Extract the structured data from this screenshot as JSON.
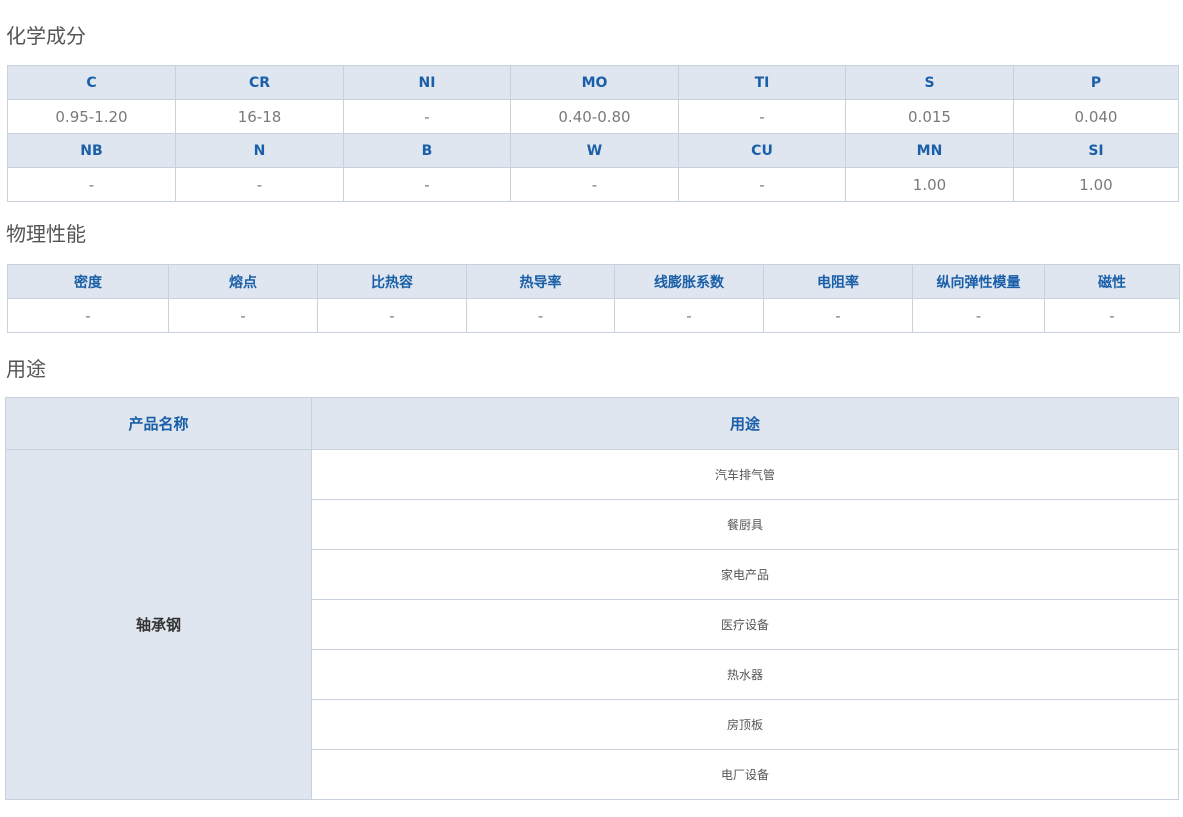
{
  "chemical": {
    "title": "化学成分",
    "rows": [
      {
        "headers": [
          "C",
          "CR",
          "NI",
          "MO",
          "TI",
          "S",
          "P"
        ],
        "values": [
          "0.95-1.20",
          "16-18",
          "-",
          "0.40-0.80",
          "-",
          "0.015",
          "0.040"
        ]
      },
      {
        "headers": [
          "NB",
          "N",
          "B",
          "W",
          "CU",
          "MN",
          "SI"
        ],
        "values": [
          "-",
          "-",
          "-",
          "-",
          "-",
          "1.00",
          "1.00"
        ]
      }
    ]
  },
  "physical": {
    "title": "物理性能",
    "headers": [
      "密度",
      "熔点",
      "比热容",
      "热导率",
      "线膨胀系数",
      "电阻率",
      "纵向弹性模量",
      "磁性"
    ],
    "values": [
      "-",
      "-",
      "-",
      "-",
      "-",
      "-",
      "-",
      "-"
    ]
  },
  "usage": {
    "title": "用途",
    "col_name": "产品名称",
    "col_use": "用途",
    "product": "轴承钢",
    "items": [
      "汽车排气管",
      "餐厨具",
      "家电产品",
      "医疗设备",
      "热水器",
      "房顶板",
      "电厂设备"
    ]
  }
}
